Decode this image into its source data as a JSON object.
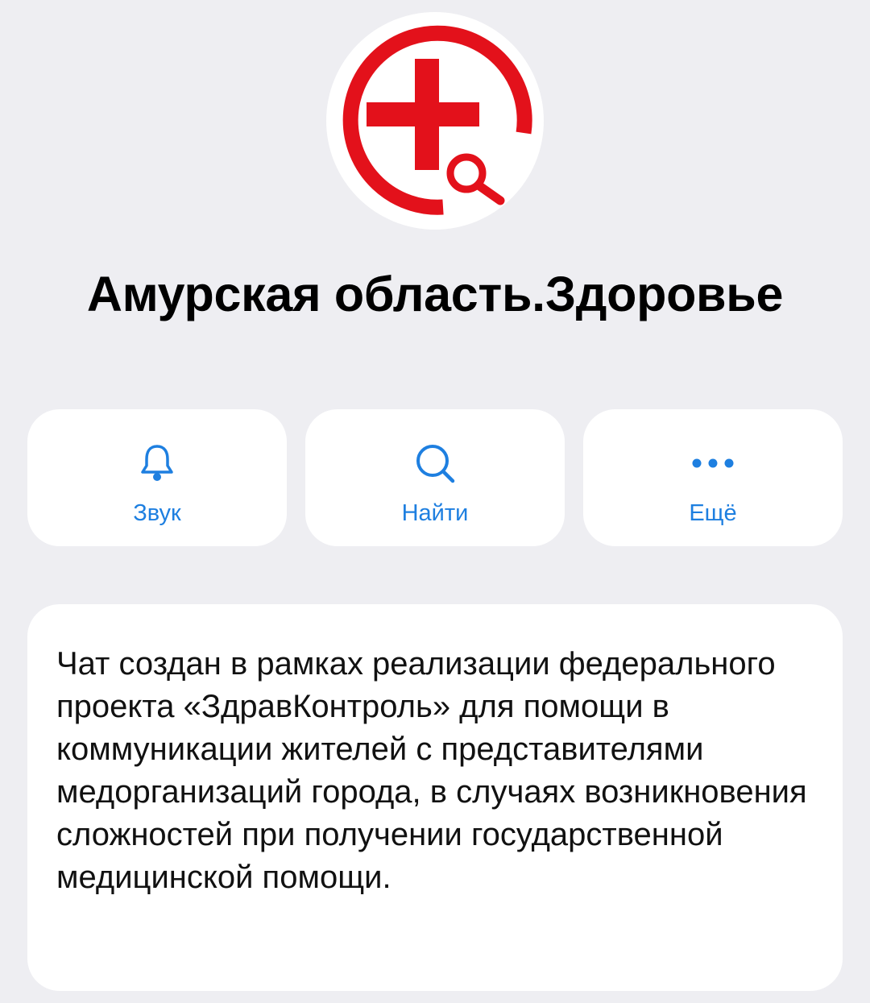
{
  "channel": {
    "name": "Амурская область.Здоровье",
    "logo_icon": "red-cross-search-logo-icon",
    "brand_color": "#e3111b",
    "description": "Чат создан в рамках реализации федерального проекта «ЗдравКонтроль» для помощи в коммуникации жителей с представителями медорганизаций города, в случаях возникновения сложностей при получении государственной медицинской помощи."
  },
  "actions": [
    {
      "label": "Звук",
      "icon": "bell-icon"
    },
    {
      "label": "Найти",
      "icon": "search-icon"
    },
    {
      "label": "Ещё",
      "icon": "more-dots-icon"
    }
  ],
  "colors": {
    "accent": "#1e7fe0",
    "background": "#eeeef2",
    "card": "#ffffff"
  }
}
